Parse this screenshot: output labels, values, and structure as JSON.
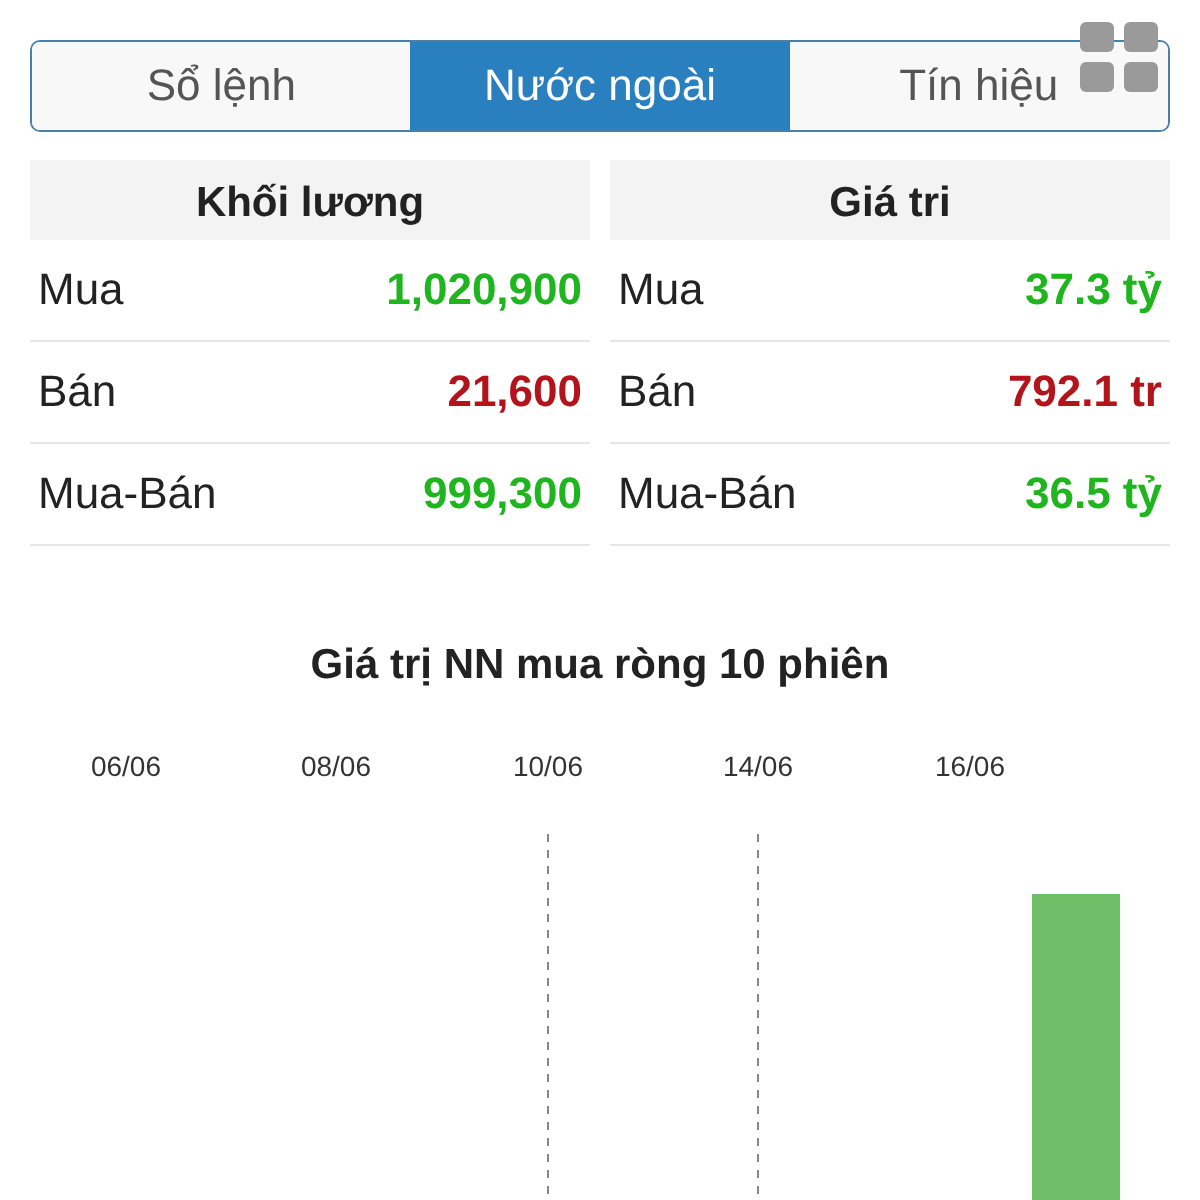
{
  "tabs": [
    {
      "label": "Sổ lệnh",
      "selected": false
    },
    {
      "label": "Nước ngoài",
      "selected": true
    },
    {
      "label": "Tín hiệu",
      "selected": false
    }
  ],
  "tables": [
    {
      "title": "Khối lương",
      "rows": [
        {
          "label": "Mua",
          "value": "1,020,900",
          "color": "#1fb51f"
        },
        {
          "label": "Bán",
          "value": "21,600",
          "color": "#b3141c"
        },
        {
          "label": "Mua-Bán",
          "value": "999,300",
          "color": "#1fb51f"
        }
      ]
    },
    {
      "title": "Giá tri",
      "rows": [
        {
          "label": "Mua",
          "value": "37.3 tỷ",
          "color": "#1fb51f"
        },
        {
          "label": "Bán",
          "value": "792.1 tr",
          "color": "#b3141c"
        },
        {
          "label": "Mua-Bán",
          "value": "36.5 tỷ",
          "color": "#1fb51f"
        }
      ]
    }
  ],
  "chart": {
    "title": "Giá trị NN mua ròng 10 phiên",
    "x_labels": [
      "06/06",
      "08/06",
      "10/06",
      "14/06",
      "16/06"
    ]
  }
}
